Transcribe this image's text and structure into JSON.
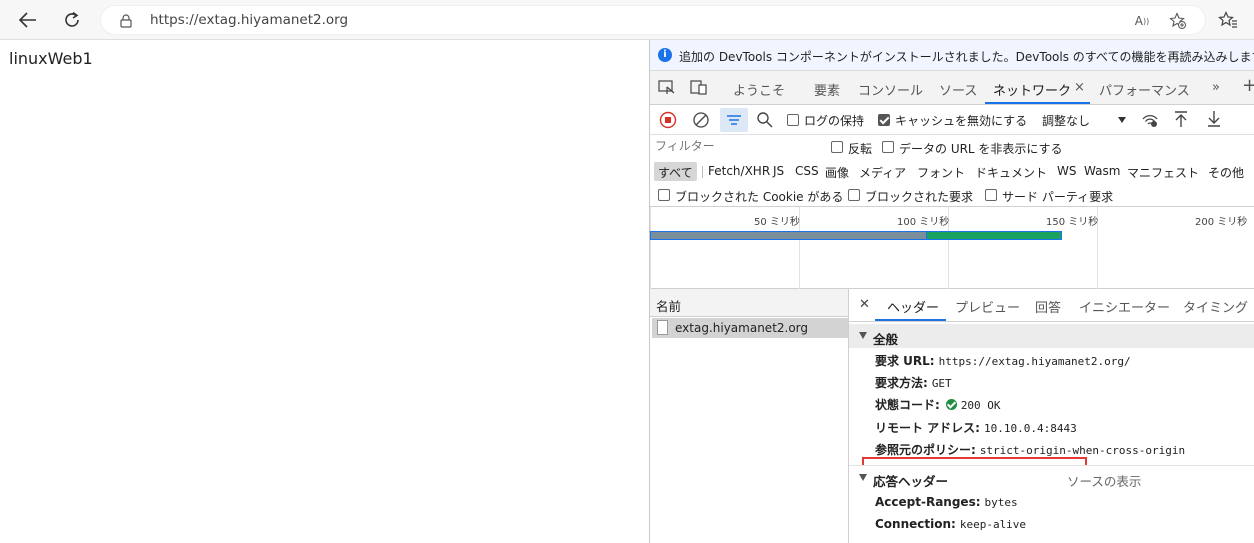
{
  "browser": {
    "url": "https://extag.hiyamanet2.org",
    "icons": [
      "back-arrow-icon",
      "refresh-icon",
      "lock-icon",
      "read-aloud-icon",
      "add-favorite-icon",
      "favorites-icon"
    ]
  },
  "page": {
    "text": "linuxWeb1"
  },
  "devtools": {
    "info_message": "追加の DevTools コンポーネントがインストールされました。DevTools のすべての機能を再読み込みします。",
    "tabs": [
      {
        "label": "ようこそ"
      },
      {
        "label": "要素"
      },
      {
        "label": "コンソール"
      },
      {
        "label": "ソース"
      },
      {
        "label": "ネットワーク"
      },
      {
        "label": "パフォーマンス"
      }
    ],
    "active_tab": "ネットワーク",
    "network_toolbar": {
      "preserve_log": "ログの保持",
      "disable_cache": "キャッシュを無効にする",
      "throttling": "調整なし"
    },
    "filter": {
      "placeholder": "フィルター",
      "invert": "反転",
      "hide_data_urls": "データの URL を非表示にする"
    },
    "types": [
      "すべて",
      "Fetch/XHR",
      "JS",
      "CSS",
      "画像",
      "メディア",
      "フォント",
      "ドキュメント",
      "WS",
      "Wasm",
      "マニフェスト",
      "その他"
    ],
    "block_options": {
      "blocked_cookies": "ブロックされた Cookie がある",
      "blocked_requests": "ブロックされた要求",
      "third_party": "サード パーティ要求"
    },
    "timeline_ticks": [
      "50 ミリ秒",
      "100 ミリ秒",
      "150 ミリ秒",
      "200 ミリ秒"
    ],
    "name_header": "名前",
    "requests": [
      "extag.hiyamanet2.org"
    ],
    "detail_tabs": [
      "ヘッダー",
      "プレビュー",
      "回答",
      "イニシエーター",
      "タイミング"
    ],
    "general": {
      "title": "全般",
      "request_url_label": "要求 URL:",
      "request_url": "https://extag.hiyamanet2.org/",
      "method_label": "要求方法:",
      "method": "GET",
      "status_label": "状態コード:",
      "status": "200 OK",
      "remote_label": "リモート アドレス:",
      "remote": "10.10.0.4:8443",
      "referrer_label": "参照元のポリシー:",
      "referrer": "strict-origin-when-cross-origin"
    },
    "response_headers": {
      "title": "応答ヘッダー",
      "view_source": "ソースの表示",
      "items": [
        {
          "key": "Accept-Ranges:",
          "value": "bytes"
        },
        {
          "key": "Connection:",
          "value": "keep-alive"
        }
      ]
    },
    "colors": {
      "accent": "#1a73e8",
      "highlight": "#e53935",
      "status_ok": "#1e8e3e"
    }
  }
}
